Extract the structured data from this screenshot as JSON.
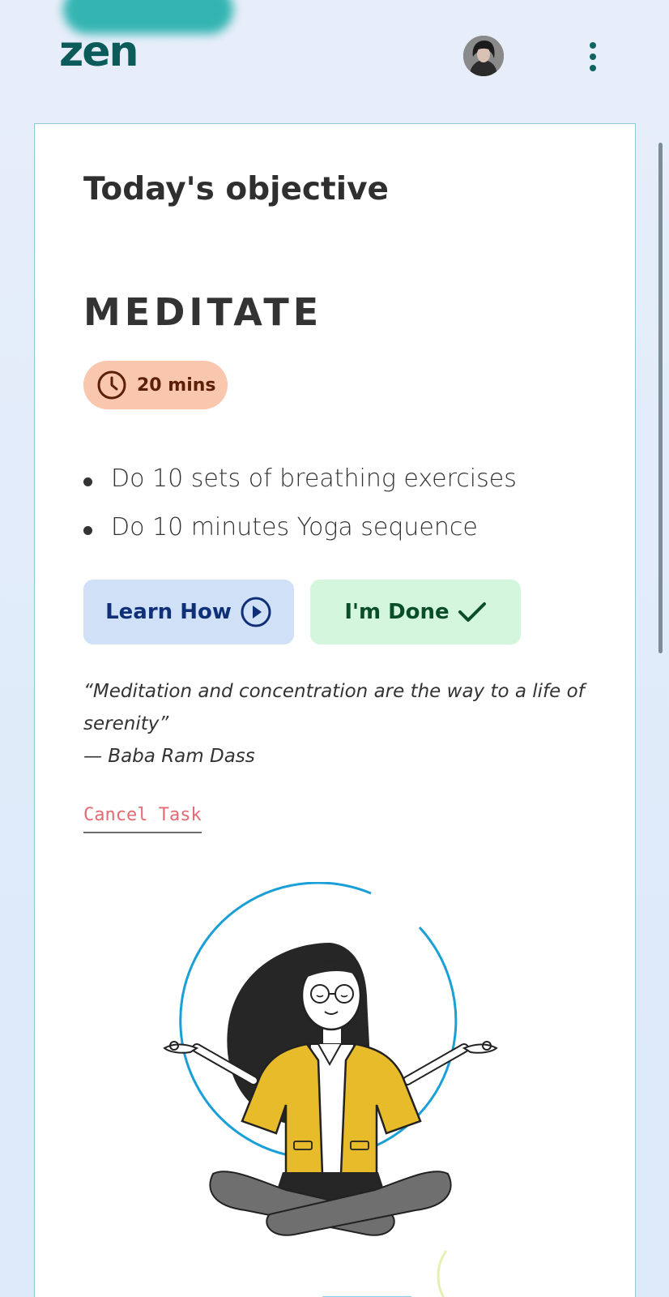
{
  "app": {
    "logo_text": "zen"
  },
  "header": {
    "avatar": "user-avatar",
    "menu_icon": "kebab-menu-icon"
  },
  "card": {
    "heading": "Today's objective",
    "task_title": "MEDITATE",
    "duration_label": "20 mins",
    "steps": [
      "Do 10 sets of breathing exercises",
      "Do 10 minutes Yoga sequence"
    ],
    "learn_button_label": "Learn How",
    "done_button_label": "I'm Done",
    "quote_text": "“Meditation and concentration are the way to a life of serenity”",
    "quote_author": "— Baba Ram Dass",
    "cancel_label": "Cancel Task"
  },
  "colors": {
    "brand": "#0b5b5a",
    "duration_badge_bg": "#f9c6ae",
    "learn_button_bg": "#cfe0f7",
    "done_button_bg": "#d3f6dc",
    "cancel_text": "#e56a71",
    "figure_jacket": "#e8bb2a"
  }
}
